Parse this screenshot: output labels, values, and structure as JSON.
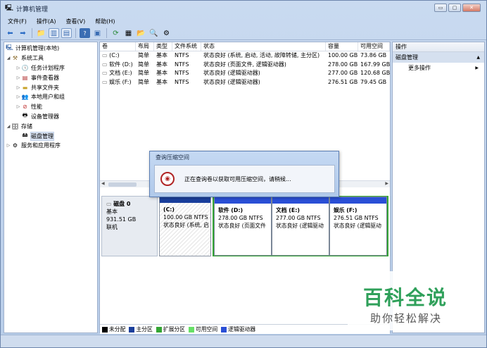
{
  "window": {
    "title": "计算机管理",
    "btn_min": "▭",
    "btn_max": "▢",
    "btn_close": "✕"
  },
  "menu": [
    "文件(F)",
    "操作(A)",
    "查看(V)",
    "帮助(H)"
  ],
  "tree": [
    {
      "label": "计算机管理(本地)",
      "icon": "computer-icon",
      "tri": "",
      "indent": 0
    },
    {
      "label": "系统工具",
      "icon": "tools-icon",
      "tri": "◢",
      "indent": 1
    },
    {
      "label": "任务计划程序",
      "icon": "clock-icon",
      "tri": "▷",
      "indent": 2
    },
    {
      "label": "事件查看器",
      "icon": "event-viewer-icon",
      "tri": "▷",
      "indent": 2
    },
    {
      "label": "共享文件夹",
      "icon": "folder-icon",
      "tri": "▷",
      "indent": 2
    },
    {
      "label": "本地用户和组",
      "icon": "users-icon",
      "tri": "▷",
      "indent": 2
    },
    {
      "label": "性能",
      "icon": "performance-icon",
      "tri": "▷",
      "indent": 2
    },
    {
      "label": "设备管理器",
      "icon": "device-manager-icon",
      "tri": "",
      "indent": 2
    },
    {
      "label": "存储",
      "icon": "storage-icon",
      "tri": "◢",
      "indent": 1
    },
    {
      "label": "磁盘管理",
      "icon": "disk-icon",
      "tri": "",
      "indent": 2,
      "selected": true
    },
    {
      "label": "服务和应用程序",
      "icon": "services-icon",
      "tri": "▷",
      "indent": 1
    }
  ],
  "volumes": {
    "headers": [
      "卷",
      "布局",
      "类型",
      "文件系统",
      "状态",
      "容量",
      "可用空间"
    ],
    "rows": [
      [
        "(C:)",
        "简单",
        "基本",
        "NTFS",
        "状态良好 (系统, 启动, 活动, 故障转储, 主分区)",
        "100.00 GB",
        "73.86 GB"
      ],
      [
        "软件 (D:)",
        "简单",
        "基本",
        "NTFS",
        "状态良好 (页面文件, 逻辑驱动器)",
        "278.00 GB",
        "167.99 GB"
      ],
      [
        "文档 (E:)",
        "简单",
        "基本",
        "NTFS",
        "状态良好 (逻辑驱动器)",
        "277.00 GB",
        "120.68 GB"
      ],
      [
        "娱乐 (F:)",
        "简单",
        "基本",
        "NTFS",
        "状态良好 (逻辑驱动器)",
        "276.51 GB",
        "79.45 GB"
      ]
    ]
  },
  "disk": {
    "name": "磁盘 0",
    "type": "基本",
    "size": "931.51 GB",
    "status": "联机"
  },
  "partitions": [
    {
      "name": "(C:)",
      "size": "100.00 GB NTFS",
      "status": "状态良好 (系统, 启"
    },
    {
      "name": "软件  (D:)",
      "size": "278.00 GB NTFS",
      "status": "状态良好 (页面文件"
    },
    {
      "name": "文档  (E:)",
      "size": "277.00 GB NTFS",
      "status": "状态良好 (逻辑驱动"
    },
    {
      "name": "娱乐  (F:)",
      "size": "276.51 GB NTFS",
      "status": "状态良好 (逻辑驱动"
    }
  ],
  "legend": [
    {
      "label": "未分配",
      "color": "#000000"
    },
    {
      "label": "主分区",
      "color": "#1a3f9c"
    },
    {
      "label": "扩展分区",
      "color": "#34a534"
    },
    {
      "label": "可用空间",
      "color": "#66e066"
    },
    {
      "label": "逻辑驱动器",
      "color": "#2a4fd6"
    }
  ],
  "actions": {
    "header": "操作",
    "section": "磁盘管理",
    "more": "更多操作"
  },
  "dialog": {
    "title": "查询压缩空间",
    "message": "正在查询卷以获取可用压缩空间，请稍候..."
  },
  "watermark": {
    "line1": "百科全说",
    "line2": "助你轻松解决"
  }
}
